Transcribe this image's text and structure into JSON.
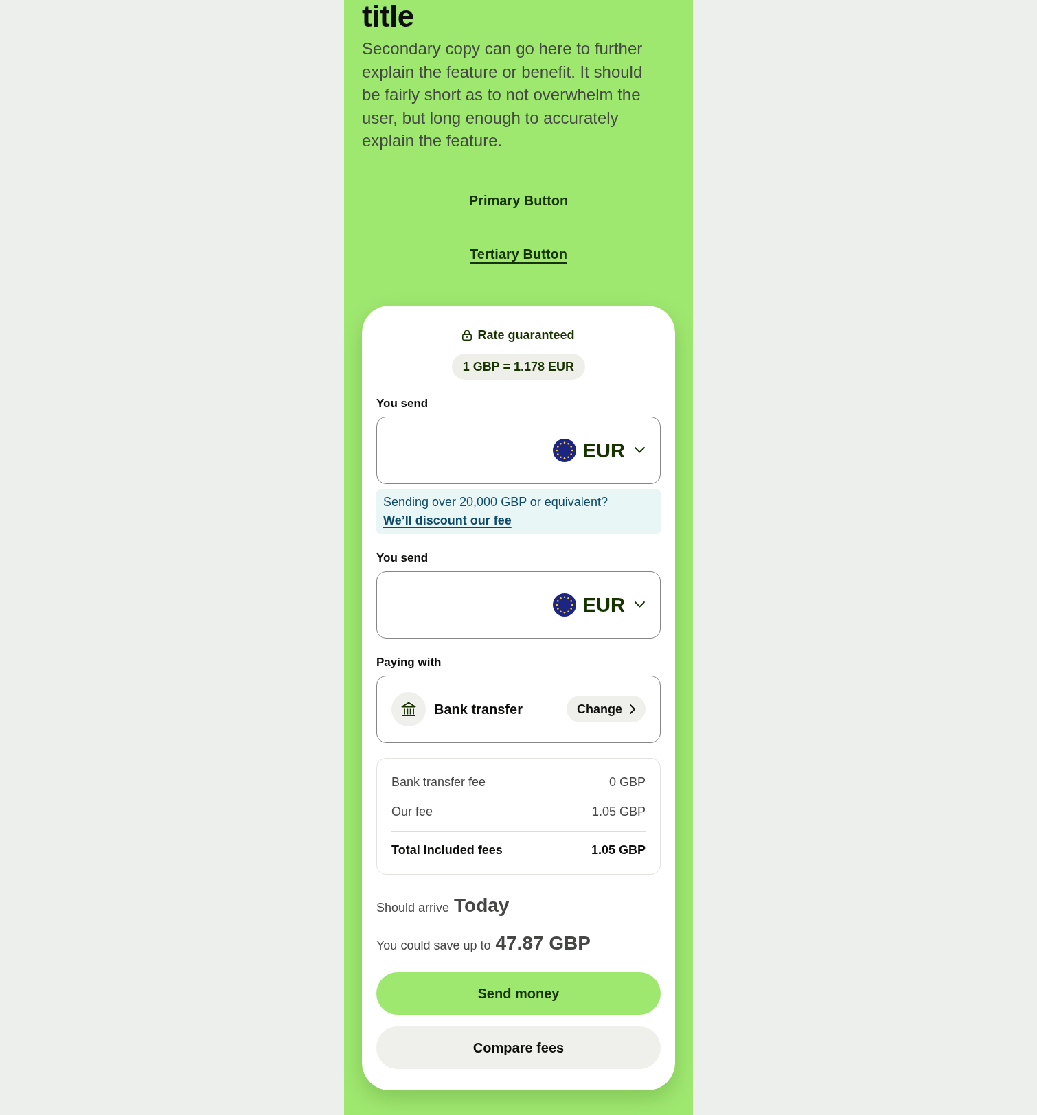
{
  "hero": {
    "title": "title",
    "description": "Secondary copy can go here to further explain the feature or benefit. It should be fairly short as to not overwhelm the user, but long enough to accurately explain the feature.",
    "buttons": [
      {
        "kind": "primary",
        "label": "Primary Button"
      },
      {
        "kind": "tertiary",
        "label": "Tertiary Button"
      }
    ]
  },
  "card": {
    "rate_status": "Rate guaranteed",
    "rate": "1 GBP = 1.178 EUR",
    "fields": [
      {
        "kind": "amount",
        "label": "You send",
        "currency": "EUR",
        "notice": {
          "text": "Sending over 20,000 GBP or equivalent?",
          "link": "We’ll discount our fee"
        }
      },
      {
        "kind": "amount",
        "label": "You send",
        "currency": "EUR"
      },
      {
        "kind": "payment",
        "label": "Paying with",
        "method": "Bank transfer",
        "action": "Change"
      }
    ],
    "fees": [
      {
        "label": "Bank transfer fee",
        "value": "0 GBP"
      },
      {
        "label": "Our fee",
        "value": "1.05 GBP"
      }
    ],
    "total": {
      "label": "Total included fees",
      "value": "1.05 GBP"
    },
    "arrival": {
      "label": "Should arrive",
      "value": "Today"
    },
    "savings": {
      "label": "You could save up to",
      "value": "47.87 GBP"
    },
    "buttons": [
      {
        "kind": "primary",
        "label": "Send money"
      },
      {
        "kind": "secondary",
        "label": "Compare fees"
      }
    ]
  }
}
